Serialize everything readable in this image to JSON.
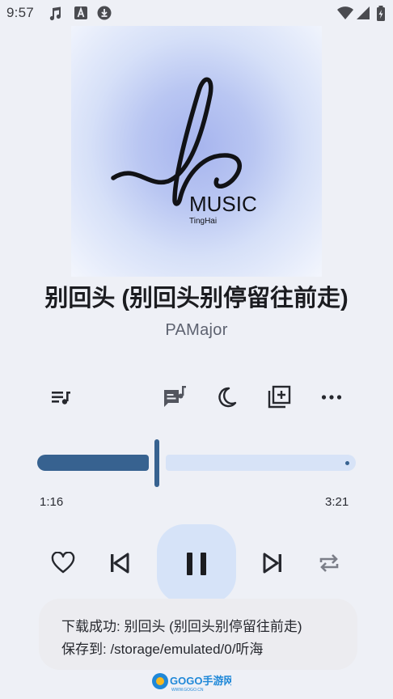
{
  "status_bar": {
    "time": "9:57",
    "left_icons": [
      "music-note-icon",
      "text-a-icon",
      "download-icon"
    ],
    "right_icons": [
      "wifi-icon",
      "signal-icon",
      "battery-charging-icon"
    ]
  },
  "album_art": {
    "logo_text": "MUSIC",
    "logo_subtext": "TingHai"
  },
  "song": {
    "title": "别回头 (别回头别停留往前走)",
    "artist": "PAMajor"
  },
  "actions": {
    "playlist_icon": "queue-music-icon",
    "lyrics_icon": "lyrics-icon",
    "sleep_timer_icon": "moon-icon",
    "add_to_playlist_icon": "library-add-icon",
    "more_icon": "more-horizontal-icon"
  },
  "playback": {
    "current_time": "1:16",
    "total_time": "3:21",
    "progress_fraction": 0.378,
    "state": "playing",
    "repeat_icon": "repeat-icon"
  },
  "toast": {
    "line1": "下载成功: 别回头 (别回头别停留往前走)",
    "line2": "保存到: /storage/emulated/0/听海"
  },
  "watermark": {
    "text": "GOGO手游网",
    "subtext": "WWW.GOGO.CN"
  },
  "colors": {
    "background": "#eef0f6",
    "accent": "#376290",
    "accent_light": "#d7e3f7"
  }
}
